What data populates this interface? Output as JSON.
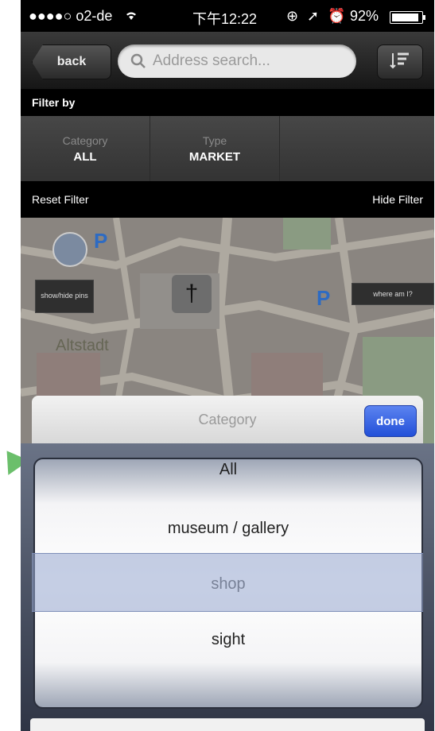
{
  "status": {
    "carrier": "●●●●○ o2-de",
    "time": "下午12:22",
    "battery": "92%",
    "battery_level_percent": 92
  },
  "nav": {
    "back_label": "back",
    "search_placeholder": "Address search..."
  },
  "filter": {
    "title": "Filter by",
    "cells": [
      {
        "label": "Category",
        "value": "ALL"
      },
      {
        "label": "Type",
        "value": "MARKET"
      }
    ],
    "reset_label": "Reset Filter",
    "hide_label": "Hide Filter"
  },
  "map": {
    "show_hide_pins": "show/hide pins",
    "where_am_i": "where am I?",
    "district_label": "Altstadt",
    "church_glyph": "†",
    "parking_label": "P"
  },
  "picker": {
    "title": "Category",
    "done_label": "done",
    "options": [
      "All",
      "museum / gallery",
      "shop",
      "sight"
    ],
    "selected": "shop"
  },
  "colors": {
    "accent_blue": "#2f5fe0",
    "arrow_green": "#6bbf6b"
  }
}
